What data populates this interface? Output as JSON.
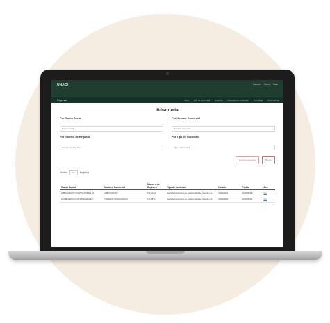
{
  "header": {
    "brand": "UNACH",
    "user_items": [
      "Usuario",
      "Menú",
      "Salir"
    ]
  },
  "nav": {
    "home": "Regresar",
    "items": [
      "Inicio",
      "Alta de empresas",
      "Registro",
      "Reportes de empresas",
      "Consultas",
      "Documentos"
    ]
  },
  "main": {
    "title": "Búsqueda",
    "fields": [
      {
        "label": "Por Razón Social",
        "placeholder": "Razón social"
      },
      {
        "label": "Por Nombre Comercial",
        "placeholder": "Nombre comercial"
      },
      {
        "label": "Por número de Registro",
        "placeholder": "Número de Registro"
      },
      {
        "label": "Por Tipo de Sociedad",
        "placeholder": "Tipo de sociedad"
      }
    ],
    "buttons": {
      "clear": "Limpiar búsqueda",
      "search": "Buscar"
    },
    "length": {
      "prefix": "Mostrar",
      "value": "10",
      "suffix": "Registros"
    },
    "table": {
      "headers": [
        "Razón Social",
        "Nombre Comercial",
        "Número de Registro",
        "Tipo de sociedad",
        "Notario",
        "Fecha",
        "Acc"
      ],
      "rows": [
        [
          "ABBA GRUPO CONSULTORES SA",
          "ABBA GRUPO",
          "TR-1024",
          "Sociedad anónima de capital variable (s.a. de c.v.)",
          "2019/0411",
          "2020/06/18",
          "Ver"
        ],
        [
          "ACME SERVICIOS INTEGRALES",
          "TORRES Y ASOCIADOS",
          "TR-0871",
          "Sociedad anónima de capital variable (s.a. de c.v.)",
          "2019/0502",
          "2020/05/12",
          "Ver"
        ]
      ]
    }
  }
}
